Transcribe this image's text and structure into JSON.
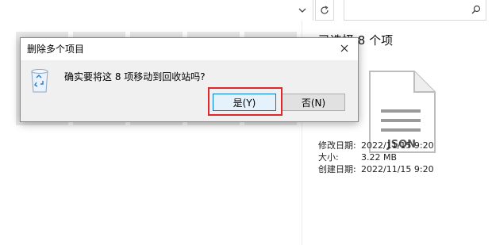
{
  "explorer": {
    "thumbnail_caption": "",
    "details": {
      "selection_count": "已选择 8 个项",
      "file_type_label": "JSON",
      "properties": [
        {
          "key": "修改日期:",
          "value": "2022/11/15 9:20"
        },
        {
          "key": "大小:",
          "value": "3.22 MB"
        },
        {
          "key": "创建日期:",
          "value": "2022/11/15 9:20"
        }
      ]
    }
  },
  "dialog": {
    "title": "删除多个项目",
    "message": "确实要将这 8 项移动到回收站吗?",
    "yes_label": "是(Y)",
    "no_label": "否(N)"
  },
  "colors": {
    "highlight": "#e0262d",
    "focus_border": "#0078d7"
  }
}
